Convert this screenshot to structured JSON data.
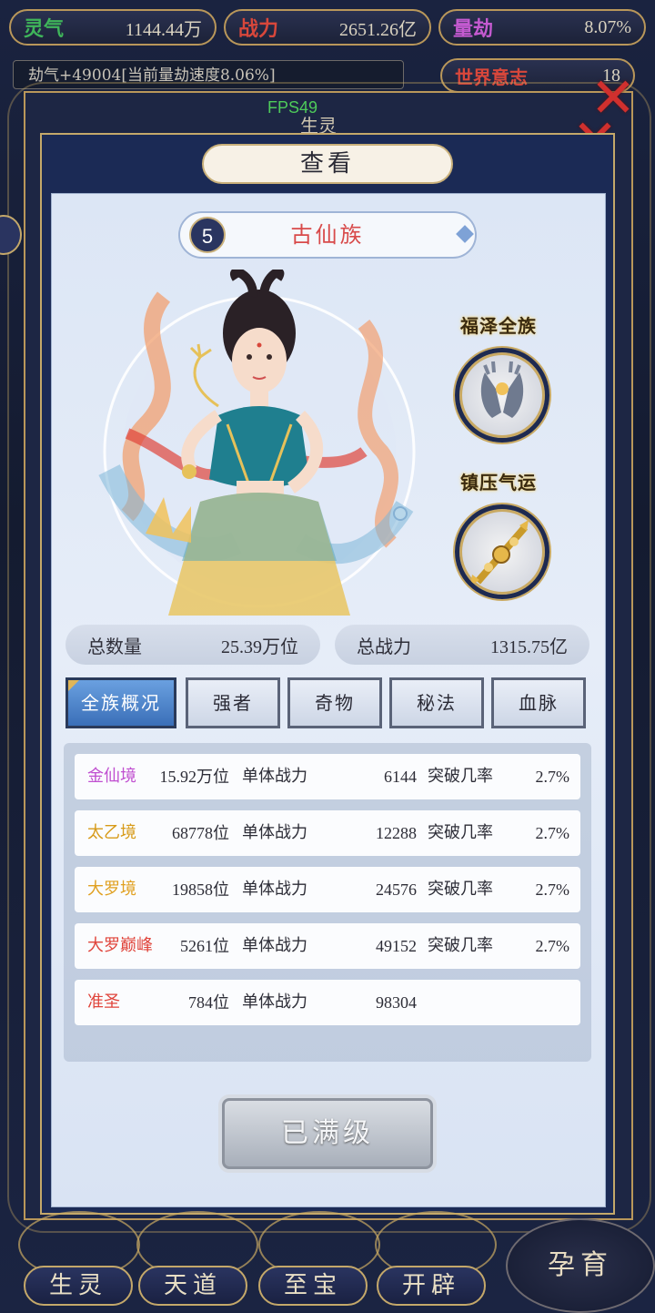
{
  "top_stats": [
    {
      "key": "灵气",
      "value": "1144.44万",
      "key_color": "#3fb55a"
    },
    {
      "key": "战力",
      "value": "2651.26亿",
      "key_color": "#d8473b"
    },
    {
      "key": "量劫",
      "value": "8.07%",
      "key_color": "#c45ad0"
    }
  ],
  "world_will": {
    "label": "世界意志",
    "value": "18"
  },
  "message": "劫气+49004[当前量劫速度8.06%]",
  "fps": "FPS49",
  "panel": {
    "title": "查看",
    "behind_label": "生灵",
    "race": {
      "level": "5",
      "name": "古仙族"
    },
    "traits": [
      {
        "label": "福泽全族",
        "icon": "blessing-hands-icon"
      },
      {
        "label": "镇压气运",
        "icon": "golden-vajra-icon"
      }
    ],
    "stats": [
      {
        "label": "总数量",
        "value": "25.39万位"
      },
      {
        "label": "总战力",
        "value": "1315.75亿"
      }
    ],
    "tabs": [
      "全族概况",
      "强者",
      "奇物",
      "秘法",
      "血脉"
    ],
    "active_tab": 0,
    "rows": [
      {
        "name": "金仙境",
        "color": "#c04fd0",
        "count": "15.92万位",
        "power_label": "单体战力",
        "power": "6144",
        "rate_label": "突破几率",
        "rate": "2.7%"
      },
      {
        "name": "太乙境",
        "color": "#d79a18",
        "count": "68778位",
        "power_label": "单体战力",
        "power": "12288",
        "rate_label": "突破几率",
        "rate": "2.7%"
      },
      {
        "name": "大罗境",
        "color": "#e0a020",
        "count": "19858位",
        "power_label": "单体战力",
        "power": "24576",
        "rate_label": "突破几率",
        "rate": "2.7%"
      },
      {
        "name": "大罗巅峰",
        "color": "#e0443b",
        "count": "5261位",
        "power_label": "单体战力",
        "power": "49152",
        "rate_label": "突破几率",
        "rate": "2.7%"
      },
      {
        "name": "准圣",
        "color": "#e0443b",
        "count": "784位",
        "power_label": "单体战力",
        "power": "98304",
        "rate_label": "",
        "rate": ""
      }
    ],
    "max_button": "已满级"
  },
  "bottom_nav": [
    "生灵",
    "天道",
    "至宝",
    "开辟"
  ],
  "yunyu": "孕育"
}
